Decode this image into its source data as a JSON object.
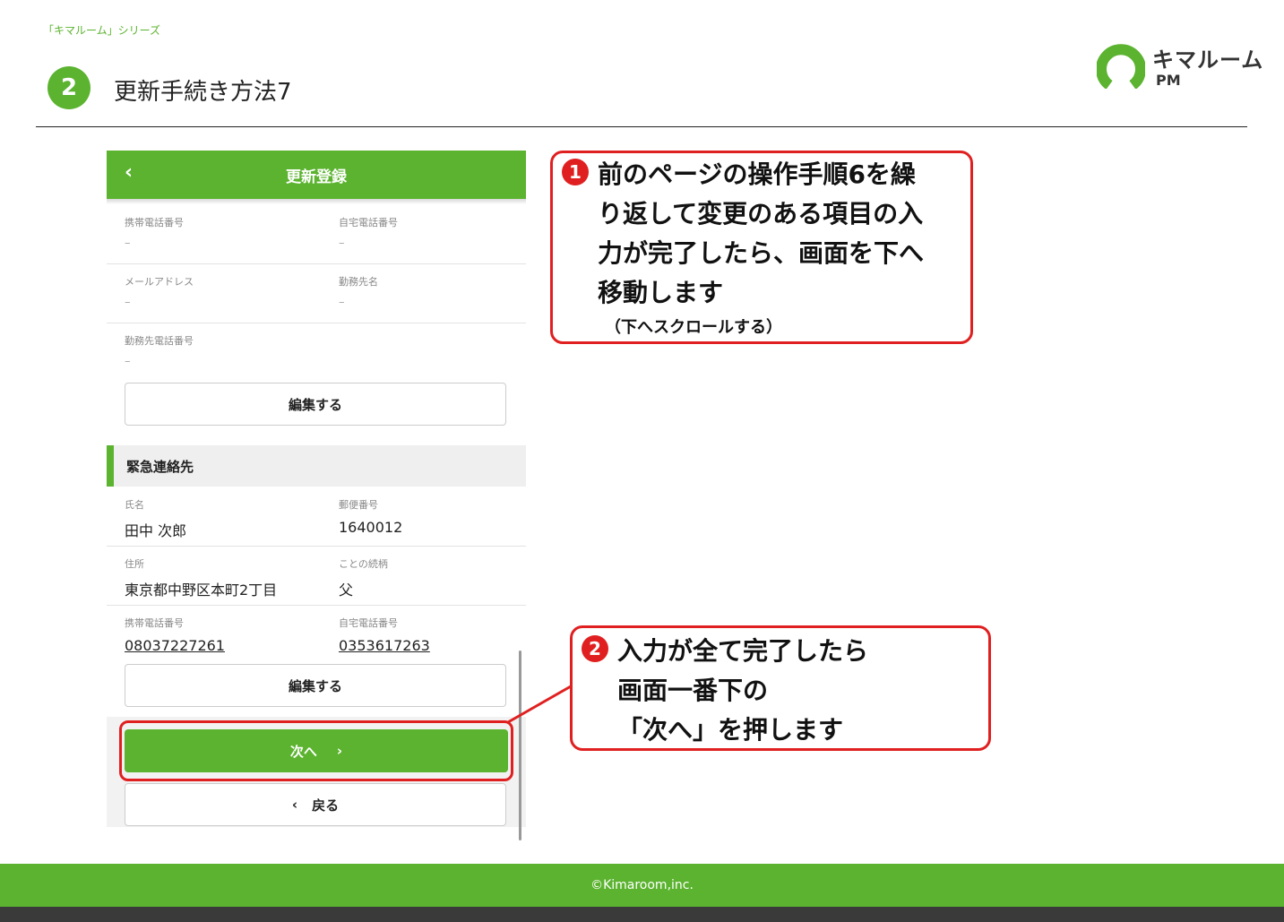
{
  "header": {
    "series": "「キマルーム」シリーズ",
    "step_number": "2",
    "title": "更新手続き方法7",
    "logo_name": "キマルーム",
    "logo_sub": "PM",
    "brand_color": "#5bb32f"
  },
  "app": {
    "back_icon": "chevron-left-icon",
    "title": "更新登録",
    "contact_rows": [
      {
        "left_label": "携帯電話番号",
        "left_value": "–",
        "right_label": "自宅電話番号",
        "right_value": "–"
      },
      {
        "left_label": "メールアドレス",
        "left_value": "–",
        "right_label": "勤務先名",
        "right_value": "–"
      },
      {
        "left_label": "勤務先電話番号",
        "left_value": "–"
      }
    ],
    "edit_label": "編集する",
    "emergency_section": "緊急連絡先",
    "emergency_rows": [
      {
        "left_label": "氏名",
        "left_value": "田中 次郎",
        "right_label": "郵便番号",
        "right_value": "1640012"
      },
      {
        "left_label": "住所",
        "left_value": "東京都中野区本町2丁目",
        "right_label": "ことの続柄",
        "right_value": "父"
      },
      {
        "left_label": "携帯電話番号",
        "left_value": "08037227261",
        "right_label": "自宅電話番号",
        "right_value": "0353617263"
      }
    ],
    "edit_label_2": "編集する",
    "next_label": "次へ",
    "next_icon": "chevron-right-icon",
    "back_label": "戻る",
    "back_nav_icon": "chevron-left-icon"
  },
  "callouts": {
    "one": {
      "number": "1",
      "lines": [
        "前のページの操作手順6を繰",
        "り返して変更のある項目の入",
        "力が完了したら、画面を下へ",
        "移動します"
      ],
      "note": "（下へスクロールする）"
    },
    "two": {
      "number": "2",
      "lines": [
        "入力が全て完了したら",
        "画面一番下の",
        "「次へ」を押します"
      ]
    },
    "highlight_color": "#e02020"
  },
  "footer": {
    "copyright": "©Kimaroom,inc."
  }
}
